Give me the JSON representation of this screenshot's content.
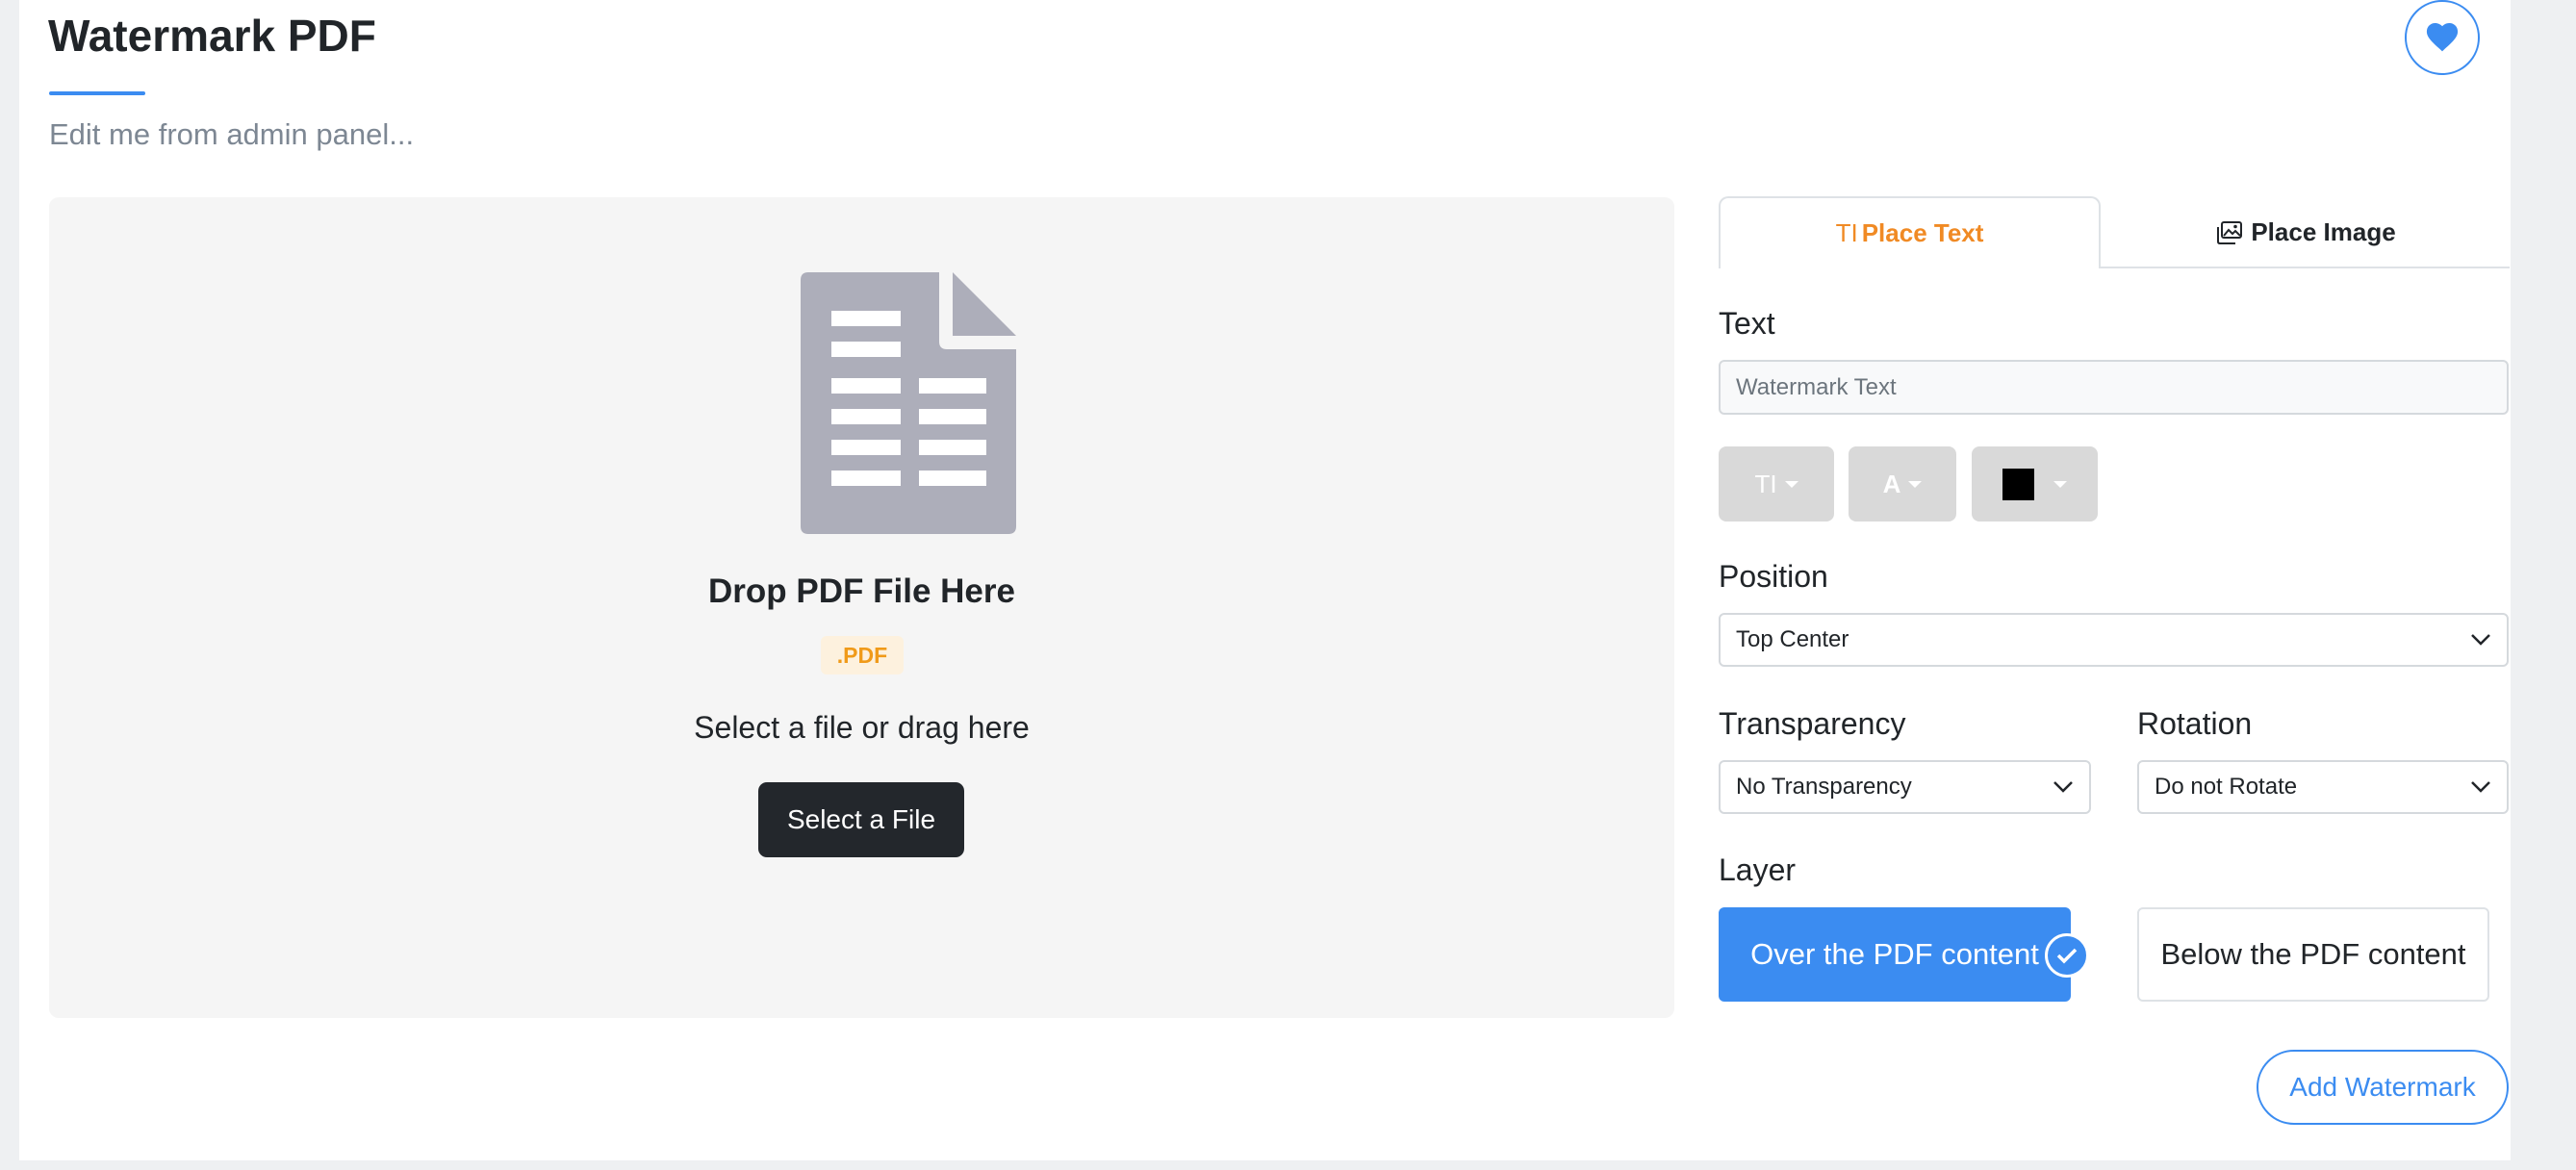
{
  "page": {
    "title": "Watermark PDF",
    "subtitle": "Edit me from admin panel..."
  },
  "header": {
    "favorite_icon": "heart-icon"
  },
  "uploader": {
    "icon": "pdf-document-icon",
    "drop_title": "Drop PDF File Here",
    "file_extension": ".PDF",
    "hint": "Select a file or drag here",
    "select_button": "Select a File"
  },
  "tabs": [
    {
      "icon_text": "TI",
      "label": "Place Text",
      "active": true
    },
    {
      "icon": "image-icon",
      "label": "Place Image",
      "active": false
    }
  ],
  "form": {
    "text_label": "Text",
    "text_placeholder": "Watermark Text",
    "toolbar": {
      "font_button": "TI",
      "size_button": "A",
      "color_value": "#000000"
    },
    "position_label": "Position",
    "position_value": "Top Center",
    "transparency_label": "Transparency",
    "transparency_value": "No Transparency",
    "rotation_label": "Rotation",
    "rotation_value": "Do not Rotate",
    "layer_label": "Layer",
    "layer_options": [
      "Over the PDF content",
      "Below the PDF content"
    ],
    "layer_selected": "Over the PDF content",
    "submit_button": "Add Watermark"
  },
  "colors": {
    "accent": "#3b8cf1",
    "active_tab": "#f08a24",
    "badge_text": "#f09a19",
    "dark_button": "#23272c"
  }
}
